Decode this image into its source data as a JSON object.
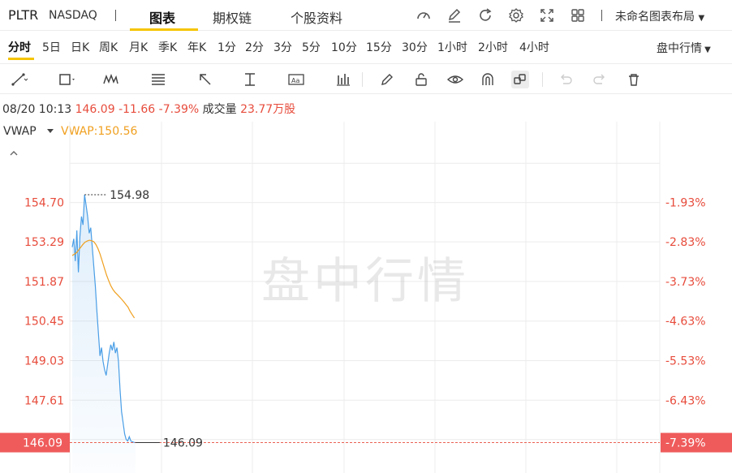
{
  "header": {
    "symbol": "PLTR",
    "exchange": "NASDAQ",
    "tabs": [
      {
        "label": "图表",
        "active": true
      },
      {
        "label": "期权链",
        "active": false
      },
      {
        "label": "个股资料",
        "active": false
      }
    ],
    "icons": [
      "gauge-icon",
      "edit-icon",
      "refresh-icon",
      "gear-icon",
      "fullscreen-icon",
      "grid-layout-icon"
    ],
    "layout_name": "未命名图表布局",
    "accent_color": "#f5c400"
  },
  "periods": {
    "items": [
      "分时",
      "5日",
      "日K",
      "周K",
      "月K",
      "季K",
      "年K",
      "1分",
      "2分",
      "3分",
      "5分",
      "10分",
      "15分",
      "30分",
      "1小时",
      "2小时",
      "4小时"
    ],
    "active": "分时",
    "market_session": "盘中行情"
  },
  "tools": [
    "trend-line-icon",
    "rectangle-icon",
    "pattern-icon",
    "fibonacci-icon",
    "arrow-icon",
    "measure-icon",
    "text-icon",
    "indicator-icon",
    "brush-icon",
    "lock-icon",
    "eye-icon",
    "magnet-icon",
    "link-icon",
    "undo-icon",
    "redo-icon",
    "trash-icon"
  ],
  "quote": {
    "datetime": "08/20 10:13",
    "price": "146.09",
    "change": "-11.66",
    "change_pct": "-7.39%",
    "volume_label": "成交量",
    "volume": "23.77万股",
    "down_color": "#e74c3c"
  },
  "indicator": {
    "name": "VWAP",
    "value_label": "VWAP:150.56",
    "vwap_color": "#f0a020"
  },
  "watermark": "盘中行情",
  "chart_data": {
    "type": "line",
    "y_ticks": [
      "154.70",
      "153.29",
      "151.87",
      "150.45",
      "149.03",
      "147.61"
    ],
    "pct_ticks": [
      "-1.93%",
      "-2.83%",
      "-3.73%",
      "-4.63%",
      "-5.53%",
      "-6.43%"
    ],
    "ylim": [
      145.0,
      157.6
    ],
    "pct_range": [
      -8.05,
      -0.08
    ],
    "high_label": "154.98",
    "last_price": "146.09",
    "last_pct": "-7.39%",
    "series": [
      {
        "name": "",
        "color": "#4a9ee6",
        "values": [
          153.1,
          153.4,
          152.6,
          153.7,
          152.2,
          153.5,
          154.2,
          153.9,
          154.98,
          154.6,
          154.2,
          153.6,
          153.8,
          153.1,
          152.4,
          151.7,
          150.8,
          150.0,
          149.2,
          149.5,
          149.0,
          148.7,
          148.5,
          148.9,
          149.3,
          149.6,
          149.4,
          149.7,
          149.3,
          149.5,
          149.0,
          148.0,
          147.2,
          146.8,
          146.4,
          146.2,
          146.15,
          146.3,
          146.15,
          146.12,
          146.1,
          146.09
        ]
      },
      {
        "name": "VWAP",
        "color": "#f0a020",
        "values": [
          152.8,
          152.85,
          152.9,
          153.0,
          153.1,
          153.2,
          153.28,
          153.32,
          153.35,
          153.33,
          153.3,
          153.2,
          153.05,
          152.85,
          152.6,
          152.35,
          152.1,
          151.9,
          151.72,
          151.58,
          151.48,
          151.4,
          151.32,
          151.24,
          151.15,
          151.05,
          150.95,
          150.8,
          150.68,
          150.56
        ]
      }
    ]
  }
}
